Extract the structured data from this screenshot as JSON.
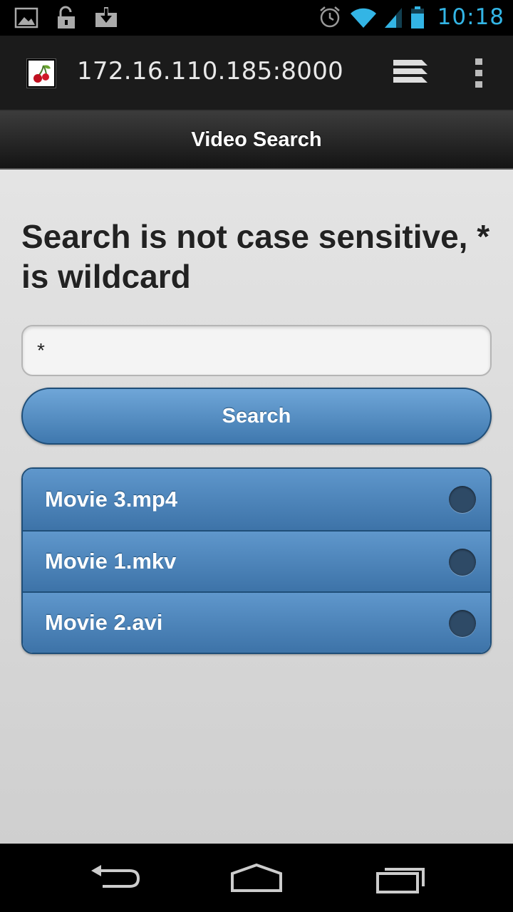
{
  "status_bar": {
    "time": "10:18",
    "icons": [
      "picture-icon",
      "unlock-icon",
      "download-icon",
      "alarm-icon",
      "wifi-icon",
      "signal-icon",
      "battery-icon"
    ]
  },
  "browser": {
    "url": "172.16.110.185:8000",
    "favicon": "cherry-favicon-icon"
  },
  "header": {
    "title": "Video Search"
  },
  "main": {
    "heading": "Search is not case sensitive, * is wildcard",
    "search": {
      "value": "*",
      "placeholder": ""
    },
    "search_button_label": "Search",
    "results": [
      {
        "label": "Movie 3.mp4"
      },
      {
        "label": "Movie 1.mkv"
      },
      {
        "label": "Movie 2.avi"
      }
    ]
  },
  "colors": {
    "accent": "#33b5e5",
    "button": "#4f89bf",
    "button_border": "#1f4e78",
    "page_bg": "#dcdcdc"
  }
}
